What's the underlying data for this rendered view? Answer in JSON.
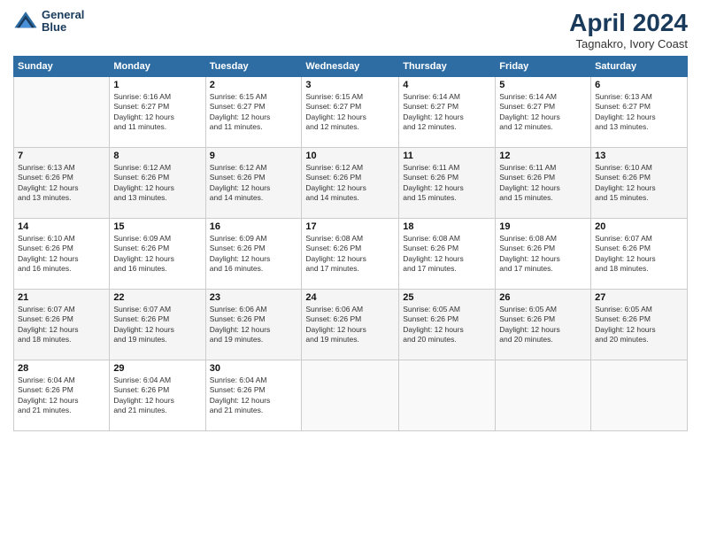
{
  "header": {
    "logo_line1": "General",
    "logo_line2": "Blue",
    "title": "April 2024",
    "subtitle": "Tagnakro, Ivory Coast"
  },
  "columns": [
    "Sunday",
    "Monday",
    "Tuesday",
    "Wednesday",
    "Thursday",
    "Friday",
    "Saturday"
  ],
  "weeks": [
    [
      {
        "day": "",
        "info": ""
      },
      {
        "day": "1",
        "info": "Sunrise: 6:16 AM\nSunset: 6:27 PM\nDaylight: 12 hours\nand 11 minutes."
      },
      {
        "day": "2",
        "info": "Sunrise: 6:15 AM\nSunset: 6:27 PM\nDaylight: 12 hours\nand 11 minutes."
      },
      {
        "day": "3",
        "info": "Sunrise: 6:15 AM\nSunset: 6:27 PM\nDaylight: 12 hours\nand 12 minutes."
      },
      {
        "day": "4",
        "info": "Sunrise: 6:14 AM\nSunset: 6:27 PM\nDaylight: 12 hours\nand 12 minutes."
      },
      {
        "day": "5",
        "info": "Sunrise: 6:14 AM\nSunset: 6:27 PM\nDaylight: 12 hours\nand 12 minutes."
      },
      {
        "day": "6",
        "info": "Sunrise: 6:13 AM\nSunset: 6:27 PM\nDaylight: 12 hours\nand 13 minutes."
      }
    ],
    [
      {
        "day": "7",
        "info": "Sunrise: 6:13 AM\nSunset: 6:26 PM\nDaylight: 12 hours\nand 13 minutes."
      },
      {
        "day": "8",
        "info": "Sunrise: 6:12 AM\nSunset: 6:26 PM\nDaylight: 12 hours\nand 13 minutes."
      },
      {
        "day": "9",
        "info": "Sunrise: 6:12 AM\nSunset: 6:26 PM\nDaylight: 12 hours\nand 14 minutes."
      },
      {
        "day": "10",
        "info": "Sunrise: 6:12 AM\nSunset: 6:26 PM\nDaylight: 12 hours\nand 14 minutes."
      },
      {
        "day": "11",
        "info": "Sunrise: 6:11 AM\nSunset: 6:26 PM\nDaylight: 12 hours\nand 15 minutes."
      },
      {
        "day": "12",
        "info": "Sunrise: 6:11 AM\nSunset: 6:26 PM\nDaylight: 12 hours\nand 15 minutes."
      },
      {
        "day": "13",
        "info": "Sunrise: 6:10 AM\nSunset: 6:26 PM\nDaylight: 12 hours\nand 15 minutes."
      }
    ],
    [
      {
        "day": "14",
        "info": "Sunrise: 6:10 AM\nSunset: 6:26 PM\nDaylight: 12 hours\nand 16 minutes."
      },
      {
        "day": "15",
        "info": "Sunrise: 6:09 AM\nSunset: 6:26 PM\nDaylight: 12 hours\nand 16 minutes."
      },
      {
        "day": "16",
        "info": "Sunrise: 6:09 AM\nSunset: 6:26 PM\nDaylight: 12 hours\nand 16 minutes."
      },
      {
        "day": "17",
        "info": "Sunrise: 6:08 AM\nSunset: 6:26 PM\nDaylight: 12 hours\nand 17 minutes."
      },
      {
        "day": "18",
        "info": "Sunrise: 6:08 AM\nSunset: 6:26 PM\nDaylight: 12 hours\nand 17 minutes."
      },
      {
        "day": "19",
        "info": "Sunrise: 6:08 AM\nSunset: 6:26 PM\nDaylight: 12 hours\nand 17 minutes."
      },
      {
        "day": "20",
        "info": "Sunrise: 6:07 AM\nSunset: 6:26 PM\nDaylight: 12 hours\nand 18 minutes."
      }
    ],
    [
      {
        "day": "21",
        "info": "Sunrise: 6:07 AM\nSunset: 6:26 PM\nDaylight: 12 hours\nand 18 minutes."
      },
      {
        "day": "22",
        "info": "Sunrise: 6:07 AM\nSunset: 6:26 PM\nDaylight: 12 hours\nand 19 minutes."
      },
      {
        "day": "23",
        "info": "Sunrise: 6:06 AM\nSunset: 6:26 PM\nDaylight: 12 hours\nand 19 minutes."
      },
      {
        "day": "24",
        "info": "Sunrise: 6:06 AM\nSunset: 6:26 PM\nDaylight: 12 hours\nand 19 minutes."
      },
      {
        "day": "25",
        "info": "Sunrise: 6:05 AM\nSunset: 6:26 PM\nDaylight: 12 hours\nand 20 minutes."
      },
      {
        "day": "26",
        "info": "Sunrise: 6:05 AM\nSunset: 6:26 PM\nDaylight: 12 hours\nand 20 minutes."
      },
      {
        "day": "27",
        "info": "Sunrise: 6:05 AM\nSunset: 6:26 PM\nDaylight: 12 hours\nand 20 minutes."
      }
    ],
    [
      {
        "day": "28",
        "info": "Sunrise: 6:04 AM\nSunset: 6:26 PM\nDaylight: 12 hours\nand 21 minutes."
      },
      {
        "day": "29",
        "info": "Sunrise: 6:04 AM\nSunset: 6:26 PM\nDaylight: 12 hours\nand 21 minutes."
      },
      {
        "day": "30",
        "info": "Sunrise: 6:04 AM\nSunset: 6:26 PM\nDaylight: 12 hours\nand 21 minutes."
      },
      {
        "day": "",
        "info": ""
      },
      {
        "day": "",
        "info": ""
      },
      {
        "day": "",
        "info": ""
      },
      {
        "day": "",
        "info": ""
      }
    ]
  ]
}
